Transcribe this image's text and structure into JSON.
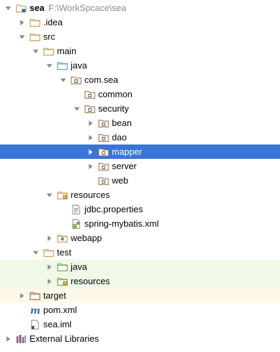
{
  "project": {
    "name": "sea",
    "path": "F:\\WorkSpcace\\sea"
  },
  "nodes": [
    {
      "label": "sea",
      "bold": true,
      "path": "F:\\WorkSpcace\\sea",
      "depth": 0,
      "arrow": "down",
      "icon": "module-folder-icon",
      "name": "project-root-sea"
    },
    {
      "label": ".idea",
      "depth": 1,
      "arrow": "right",
      "icon": "folder-icon",
      "name": "tree-node-idea"
    },
    {
      "label": "src",
      "depth": 1,
      "arrow": "down",
      "icon": "folder-icon",
      "name": "tree-node-src"
    },
    {
      "label": "main",
      "depth": 2,
      "arrow": "down",
      "icon": "folder-icon",
      "name": "tree-node-main"
    },
    {
      "label": "java",
      "depth": 3,
      "arrow": "down",
      "icon": "source-root-folder-icon",
      "name": "tree-node-main-java"
    },
    {
      "label": "com.sea",
      "depth": 4,
      "arrow": "down",
      "icon": "package-icon",
      "name": "tree-node-com-sea"
    },
    {
      "label": "common",
      "depth": 5,
      "arrow": "none",
      "icon": "package-icon",
      "name": "tree-node-common"
    },
    {
      "label": "security",
      "depth": 5,
      "arrow": "down",
      "icon": "package-icon",
      "name": "tree-node-security"
    },
    {
      "label": "bean",
      "depth": 6,
      "arrow": "right",
      "icon": "package-icon",
      "name": "tree-node-bean"
    },
    {
      "label": "dao",
      "depth": 6,
      "arrow": "right",
      "icon": "package-icon",
      "name": "tree-node-dao"
    },
    {
      "label": "mapper",
      "depth": 6,
      "arrow": "right",
      "icon": "package-icon",
      "selected": true,
      "name": "tree-node-mapper"
    },
    {
      "label": "server",
      "depth": 6,
      "arrow": "right",
      "icon": "package-icon",
      "name": "tree-node-server"
    },
    {
      "label": "web",
      "depth": 6,
      "arrow": "none",
      "icon": "package-icon",
      "name": "tree-node-web"
    },
    {
      "label": "resources",
      "depth": 3,
      "arrow": "down",
      "icon": "resources-folder-icon",
      "name": "tree-node-main-resources"
    },
    {
      "label": "jdbc.properties",
      "depth": 4,
      "arrow": "none",
      "icon": "properties-file-icon",
      "name": "tree-node-jdbc-properties"
    },
    {
      "label": "spring-mybatis.xml",
      "depth": 4,
      "arrow": "none",
      "icon": "spring-xml-file-icon",
      "name": "tree-node-spring-mybatis-xml"
    },
    {
      "label": "webapp",
      "depth": 3,
      "arrow": "right",
      "icon": "web-folder-icon",
      "name": "tree-node-webapp"
    },
    {
      "label": "test",
      "depth": 2,
      "arrow": "down",
      "icon": "folder-icon",
      "name": "tree-node-test"
    },
    {
      "label": "java",
      "depth": 3,
      "arrow": "right",
      "icon": "test-source-folder-icon",
      "bg": "test",
      "name": "tree-node-test-java"
    },
    {
      "label": "resources",
      "depth": 3,
      "arrow": "right",
      "icon": "test-resources-folder-icon",
      "bg": "test",
      "name": "tree-node-test-resources"
    },
    {
      "label": "target",
      "depth": 1,
      "arrow": "right",
      "icon": "excluded-folder-icon",
      "bg": "target",
      "name": "tree-node-target"
    },
    {
      "label": "pom.xml",
      "depth": 1,
      "arrow": "none",
      "icon": "maven-file-icon",
      "name": "tree-node-pom-xml"
    },
    {
      "label": "sea.iml",
      "depth": 1,
      "arrow": "none",
      "icon": "iml-file-icon",
      "name": "tree-node-sea-iml"
    },
    {
      "label": "External Libraries",
      "depth": 0,
      "arrow": "right",
      "icon": "libraries-icon",
      "name": "tree-node-external-libraries"
    }
  ],
  "colors": {
    "selection": "#3875d6",
    "folder": "#c9a05a",
    "source_root": "#5a9fd4",
    "test_root": "#6aab4a",
    "package": "#a08050",
    "excluded": "#c06040"
  }
}
